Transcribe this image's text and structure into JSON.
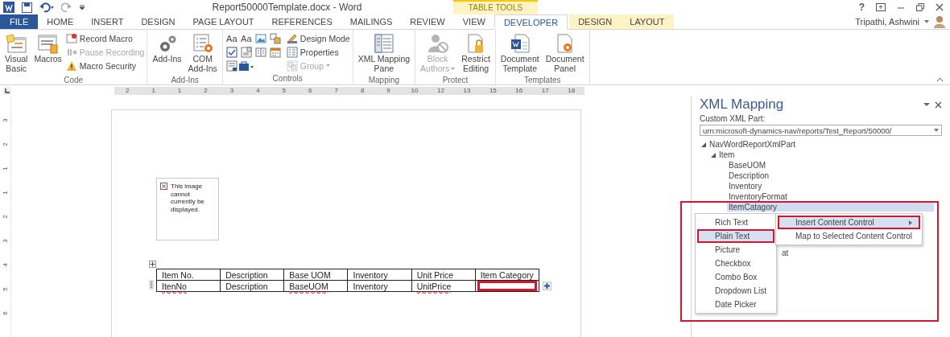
{
  "window": {
    "title": "Report50000Template.docx - Word",
    "help": "?",
    "user": "Tripathi, Ashwini"
  },
  "contextual_tab_group": {
    "label": "TABLE TOOLS"
  },
  "tabs": [
    {
      "label": "FILE",
      "kind": "file",
      "selected": false
    },
    {
      "label": "HOME",
      "kind": "main",
      "selected": false
    },
    {
      "label": "INSERT",
      "kind": "main",
      "selected": false
    },
    {
      "label": "DESIGN",
      "kind": "main",
      "selected": false
    },
    {
      "label": "PAGE LAYOUT",
      "kind": "main",
      "selected": false
    },
    {
      "label": "REFERENCES",
      "kind": "main",
      "selected": false
    },
    {
      "label": "MAILINGS",
      "kind": "main",
      "selected": false
    },
    {
      "label": "REVIEW",
      "kind": "main",
      "selected": false
    },
    {
      "label": "VIEW",
      "kind": "main",
      "selected": false
    },
    {
      "label": "DEVELOPER",
      "kind": "main",
      "selected": true
    },
    {
      "label": "DESIGN",
      "kind": "contextual",
      "selected": false
    },
    {
      "label": "LAYOUT",
      "kind": "contextual",
      "selected": false
    }
  ],
  "ribbon_groups": [
    {
      "label": "Code",
      "items": [
        {
          "kind": "large",
          "lines": [
            "Visual",
            "Basic"
          ],
          "disabled": false
        },
        {
          "kind": "large",
          "lines": [
            "Macros"
          ],
          "disabled": false
        },
        {
          "kind": "stack",
          "entries": [
            {
              "label": "Record Macro",
              "disabled": false
            },
            {
              "label": "Pause Recording",
              "disabled": true
            },
            {
              "label": "Macro Security",
              "disabled": false
            }
          ]
        }
      ]
    },
    {
      "label": "Add-Ins",
      "items": [
        {
          "kind": "large",
          "lines": [
            "Add-Ins"
          ],
          "disabled": false
        },
        {
          "kind": "large",
          "lines": [
            "COM",
            "Add-Ins"
          ],
          "disabled": false
        }
      ]
    },
    {
      "label": "Controls",
      "items": [
        {
          "kind": "grid",
          "text_cells": [
            "Aa",
            "Aa"
          ]
        },
        {
          "kind": "stack",
          "entries": [
            {
              "label": "Design Mode",
              "disabled": false
            },
            {
              "label": "Properties",
              "disabled": false
            },
            {
              "label": "Group",
              "disabled": true,
              "dropdown": true
            }
          ]
        }
      ]
    },
    {
      "label": "Mapping",
      "items": [
        {
          "kind": "large",
          "lines": [
            "XML Mapping",
            "Pane"
          ],
          "disabled": false
        }
      ]
    },
    {
      "label": "Protect",
      "items": [
        {
          "kind": "large",
          "lines": [
            "Block",
            "Authors"
          ],
          "disabled": true,
          "dropdown": true
        },
        {
          "kind": "large",
          "lines": [
            "Restrict",
            "Editing"
          ],
          "disabled": false
        }
      ]
    },
    {
      "label": "Templates",
      "items": [
        {
          "kind": "large",
          "lines": [
            "Document",
            "Template"
          ],
          "disabled": false
        },
        {
          "kind": "large",
          "lines": [
            "Document",
            "Panel"
          ],
          "disabled": false
        }
      ]
    }
  ],
  "ruler": {
    "horizontal": [
      "2",
      "1",
      "1",
      "2",
      "3",
      "4",
      "5",
      "6",
      "7",
      "8",
      "9",
      "10",
      "12",
      "13",
      "15",
      "16",
      "17",
      "18"
    ],
    "vertical": [
      "3",
      "2",
      "1",
      "1",
      "2",
      "3",
      "4",
      "5",
      "6"
    ]
  },
  "document": {
    "image_placeholder": {
      "message": "This image cannot currently be displayed."
    },
    "table": {
      "columns": [
        "Item No.",
        "Description",
        "Base UOM",
        "Inventory",
        "Unit Price",
        "Item Category"
      ],
      "rows": [
        {
          "cells": [
            {
              "text": "ItenNo",
              "misspelled": true,
              "highlighted": false
            },
            {
              "text": "Description",
              "misspelled": false,
              "highlighted": false
            },
            {
              "text": "BaseUOM",
              "misspelled": true,
              "highlighted": false
            },
            {
              "text": "Inventory",
              "misspelled": false,
              "highlighted": false
            },
            {
              "text": "UnitPrice",
              "misspelled": true,
              "highlighted": false
            },
            {
              "highlighted": true
            }
          ]
        }
      ]
    }
  },
  "xml_pane": {
    "title": "XML Mapping",
    "part_label": "Custom XML Part:",
    "part_value": "urn:microsoft-dynamics-nav/reports/Test_Report/50000/",
    "tree": [
      {
        "label": "NavWordReportXmlPart",
        "selected": false,
        "expanded": true,
        "children": [
          {
            "label": "Item",
            "selected": false,
            "expanded": true,
            "children": [
              {
                "label": "BaseUOM",
                "selected": false
              },
              {
                "label": "Description",
                "selected": false
              },
              {
                "label": "Inventory",
                "selected": false
              },
              {
                "label": "InventoryFormat",
                "selected": false
              },
              {
                "label": "ItemCatagory",
                "selected": true
              },
              {
                "label": "at",
                "kind": "partial",
                "selected": false
              }
            ]
          }
        ]
      }
    ]
  },
  "context_menu": {
    "annotation_frame": true,
    "items": [
      {
        "label": "Insert Content Control",
        "selected": true,
        "submenu": true,
        "framed": true
      },
      {
        "label": "Map to Selected Content Control",
        "selected": false,
        "submenu": false,
        "framed": false
      }
    ],
    "submenu": [
      {
        "label": "Rich Text",
        "selected": false,
        "framed": false
      },
      {
        "label": "Plain Text",
        "selected": true,
        "framed": true
      },
      {
        "label": "Picture",
        "selected": false,
        "framed": false
      },
      {
        "label": "Checkbox",
        "selected": false,
        "framed": false
      },
      {
        "label": "Combo Box",
        "selected": false,
        "framed": false
      },
      {
        "label": "Dropdown List",
        "selected": false,
        "framed": false
      },
      {
        "label": "Date Picker",
        "selected": false,
        "framed": false
      }
    ]
  }
}
